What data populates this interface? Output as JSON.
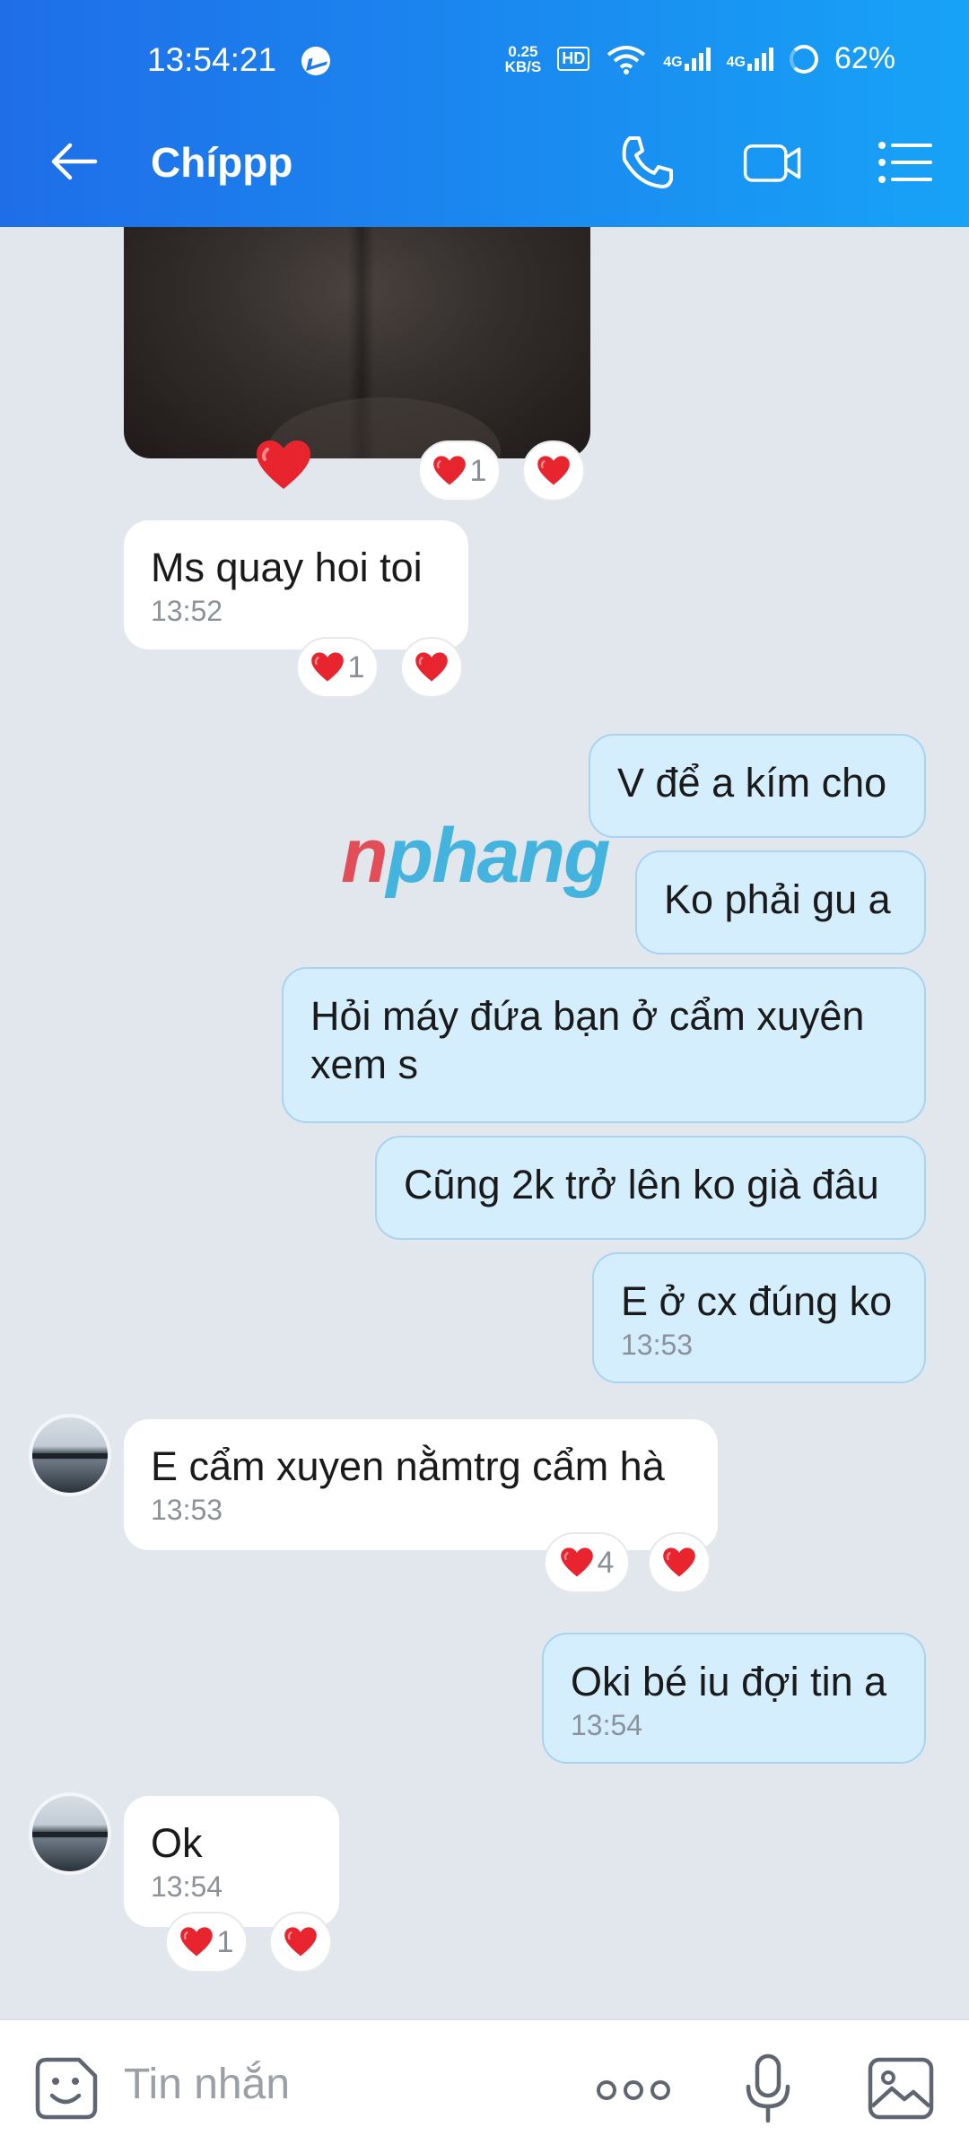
{
  "status_bar": {
    "time": "13:54:21",
    "net_speed_value": "0.25",
    "net_speed_unit": "KB/S",
    "hd_label": "HD",
    "signal_1": "4G",
    "signal_2": "4G",
    "battery": "62%"
  },
  "header": {
    "title": "Chíppp",
    "icons": [
      "back-arrow-icon",
      "phone-icon",
      "video-call-icon",
      "menu-list-icon"
    ]
  },
  "messages": [
    {
      "id": "m0",
      "side": "in",
      "type": "image",
      "reaction_count": "1"
    },
    {
      "id": "m1",
      "side": "in",
      "text": "Ms quay hoi toi",
      "time": "13:52",
      "reaction_count": "1"
    },
    {
      "id": "m2",
      "side": "out",
      "text": "V để a kím cho"
    },
    {
      "id": "m3",
      "side": "out",
      "text": "Ko phải gu a"
    },
    {
      "id": "m4",
      "side": "out",
      "text_line1": "Hỏi máy đứa bạn ở cẩm xuyên",
      "text_line2": "xem s"
    },
    {
      "id": "m5",
      "side": "out",
      "text": "Cũng 2k trở lên ko già đâu"
    },
    {
      "id": "m6",
      "side": "out",
      "text": "E ở cx đúng ko",
      "time": "13:53"
    },
    {
      "id": "m7",
      "side": "in",
      "text": "E cẩm xuyen nằmtrg cẩm hà",
      "time": "13:53",
      "reaction_count": "4"
    },
    {
      "id": "m8",
      "side": "out",
      "text": "Oki bé iu đợi tin a",
      "time": "13:54"
    },
    {
      "id": "m9",
      "side": "in",
      "text": "Ok",
      "time": "13:54",
      "reaction_count": "1"
    }
  ],
  "watermark": {
    "prefix": "n",
    "rest": "phang"
  },
  "composer": {
    "placeholder": "Tin nhắn",
    "icons": [
      "sticker-icon",
      "more-icon",
      "microphone-icon",
      "image-icon"
    ]
  },
  "colors": {
    "header_start": "#1f6ee8",
    "header_end": "#17a3f7",
    "chat_background": "#e2e7ee",
    "outgoing_bubble": "#d4eefe",
    "incoming_bubble": "#ffffff",
    "heart": "#e8242f"
  }
}
